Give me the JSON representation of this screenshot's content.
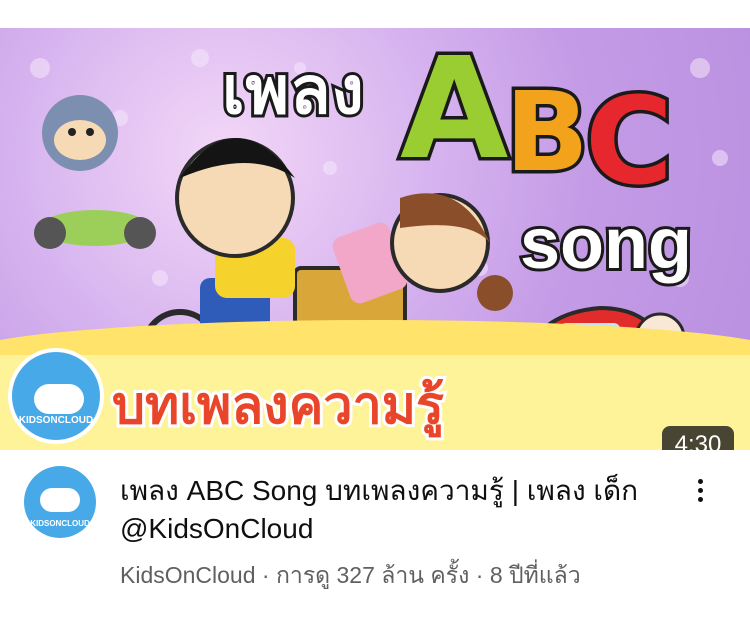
{
  "thumbnail": {
    "title_thai": "เพลง",
    "abc_letters": [
      "A",
      "B",
      "C"
    ],
    "song_text": "song",
    "subtitle_thai": "บทเพลงความรู้",
    "logo_brand": "KIDSONCLOUD",
    "duration": "4:30"
  },
  "video": {
    "title": "เพลง ABC Song บทเพลงความรู้ | เพลง เด็ก @KidsOnCloud",
    "channel": "KidsOnCloud",
    "separator": " · ",
    "views": "การดู 327 ล้าน ครั้ง",
    "age": "8 ปีที่แล้ว"
  },
  "avatar": {
    "brand": "KIDSONCLOUD"
  },
  "colors": {
    "thumb_bg": "#c49be6",
    "yellow": "#fff39a",
    "letter_a": "#9acd32",
    "letter_b": "#f2a31b",
    "letter_c": "#e6282e",
    "logo_blue": "#47a9e8",
    "meta_gray": "#606060"
  },
  "icons": {
    "more": "vertical-ellipsis-icon"
  }
}
